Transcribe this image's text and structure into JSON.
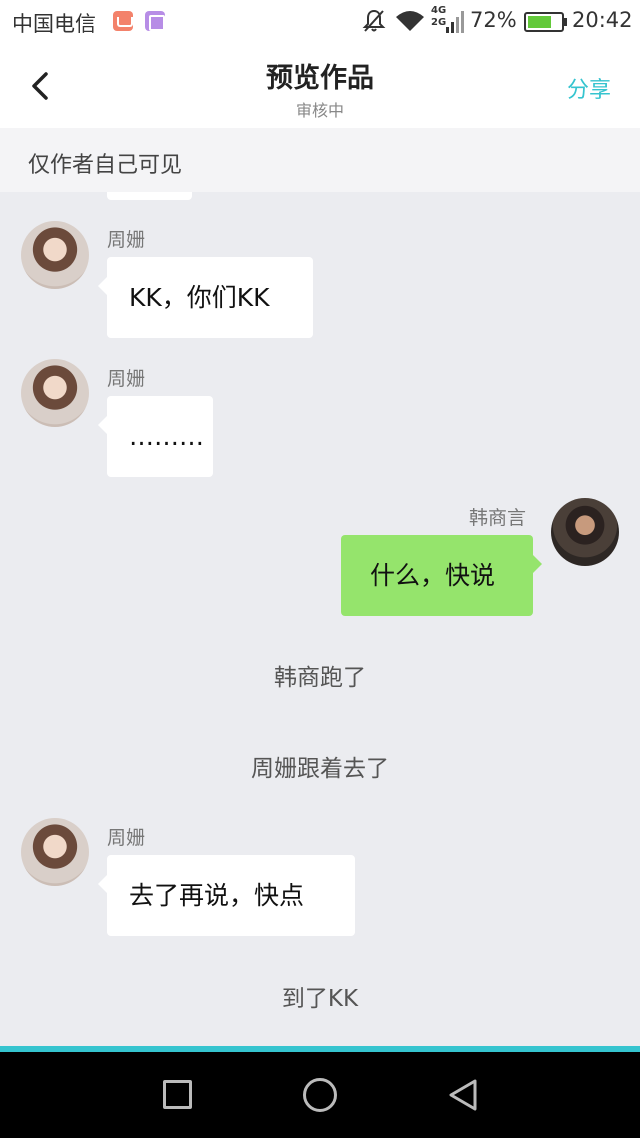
{
  "status_bar": {
    "carrier": "中国电信",
    "network": "4G\n2G",
    "battery_percent": "72%",
    "battery_level": 0.72,
    "time": "20:42",
    "icons": [
      "notification-app-icon",
      "gallery-app-icon",
      "mute-icon",
      "wifi-icon",
      "signal-icon",
      "battery-icon"
    ]
  },
  "header": {
    "title": "预览作品",
    "subtitle": "审核中",
    "share_label": "分享",
    "back_icon": "chevron-left-icon"
  },
  "notice": "仅作者自己可见",
  "colors": {
    "accent": "#35c4cf",
    "my_bubble": "#95e46c",
    "other_bubble": "#ffffff",
    "chat_background": "#ebecf0"
  },
  "messages": [
    {
      "type": "received",
      "sender": "周姗",
      "text": "KK，你们KK"
    },
    {
      "type": "received",
      "sender": "周姗",
      "text": "………"
    },
    {
      "type": "sent",
      "sender": "韩商言",
      "text": "什么，快说"
    },
    {
      "type": "narration",
      "text": "韩商跑了"
    },
    {
      "type": "narration",
      "text": "周姗跟着去了"
    },
    {
      "type": "received",
      "sender": "周姗",
      "text": "去了再说，快点"
    },
    {
      "type": "narration",
      "text": "到了KK"
    }
  ],
  "nav_bar": {
    "icons": [
      "recent-apps-icon",
      "home-icon",
      "back-triangle-icon"
    ]
  }
}
